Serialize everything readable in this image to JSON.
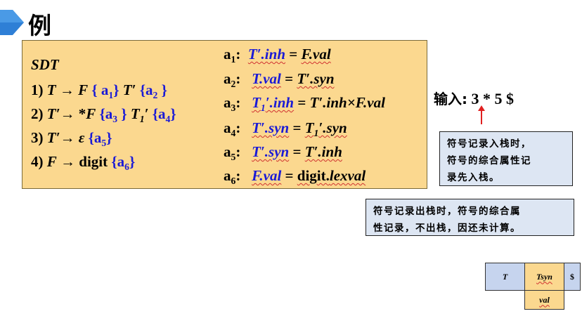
{
  "header": {
    "title": "例"
  },
  "sdt": {
    "heading": "SDT",
    "rules": {
      "r1": {
        "num": "1)",
        "lhs": "T",
        "arrow": "→",
        "f": "F",
        "a1": "{ a",
        "a1sub": "1",
        "a1close": "}",
        "tp": "T′",
        "a2": "{a",
        "a2sub": "2",
        "a2close": " }"
      },
      "r2": {
        "num": "2)",
        "lhs": "T′",
        "arrow": "→ *",
        "f": "F",
        "a3": "{a",
        "a3sub": "3",
        "a3close": " }",
        "t1": "T",
        "t1sub": "1",
        "t1prime": "′",
        "a4": "{a",
        "a4sub": "4",
        "a4close": "}"
      },
      "r3": {
        "num": "3)",
        "lhs": "T′",
        "arrow": "→",
        "eps": "ε",
        "a5": "{a",
        "a5sub": "5",
        "a5close": "}"
      },
      "r4": {
        "num": "4)",
        "lhs": "F",
        "arrow": "→",
        "digit": "digit",
        "a6": "{a",
        "a6sub": "6",
        "a6close": "}"
      }
    },
    "actions": {
      "a1": {
        "label": "a",
        "sub": "1",
        "colon": ":",
        "lhs": "T′.inh",
        "eq": "=",
        "rhs": "F.val"
      },
      "a2": {
        "label": "a",
        "sub": "2",
        "colon": ":",
        "lhs": "T.val",
        "eq": "=",
        "rhs": "T′.syn"
      },
      "a3": {
        "label": "a",
        "sub": "3",
        "colon": ":",
        "lhs_a": "T",
        "lhs_sub": "1",
        "lhs_b": "′.inh",
        "eq": "=",
        "rhs": "T′.inh×F.val"
      },
      "a4": {
        "label": "a",
        "sub": "4",
        "colon": ":",
        "lhs": "T′.syn",
        "eq": "=",
        "rhs_a": "T",
        "rhs_sub": "1",
        "rhs_b": "′.syn"
      },
      "a5": {
        "label": "a",
        "sub": "5",
        "colon": ":",
        "lhs": "T′.syn",
        "eq": "=",
        "rhs": "T′.inh"
      },
      "a6": {
        "label": "a",
        "sub": "6",
        "colon": ":",
        "lhs": "F.val",
        "eq": "=",
        "rhs_a": "digit.",
        "rhs_b": "lexval"
      }
    }
  },
  "input": {
    "label": "输入:",
    "value": "3 * 5 $"
  },
  "notes": {
    "note1": [
      "符号记录入栈时，",
      "符号的综合属性记",
      "录先入栈。"
    ],
    "note2": [
      "符号记录出栈时，符号的综合属",
      "性记录，不出栈，因还未计算。"
    ]
  },
  "stack": {
    "t": "T",
    "tsyn": "Tsyn",
    "dollar": "$",
    "val": "val"
  },
  "colors": {
    "sdt_bg": "#fbd88f",
    "note_bg": "#dde6f3",
    "stack_blue": "#c6d4ee",
    "action_blue": "#1a1ad6",
    "arrow_red": "#e02020"
  }
}
